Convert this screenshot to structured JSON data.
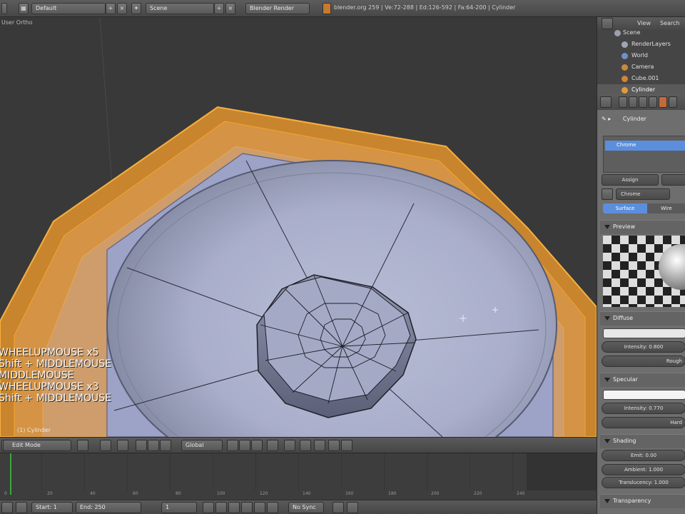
{
  "header": {
    "screen_layout": "Default",
    "scene": "Scene",
    "render_engine": "Blender Render",
    "stats": "blender.org 259 | Ve:72-288 | Ed:126-592 | Fa:64-200 | Cylinder"
  },
  "viewport": {
    "label": "User Ortho",
    "object_label": "(1) Cylinder",
    "key_history": [
      "WHEELUPMOUSE x5",
      "Shift + MIDDLEMOUSE",
      "MIDDLEMOUSE",
      "WHEELUPMOUSE x3",
      "Shift + MIDDLEMOUSE"
    ]
  },
  "view_header": {
    "mode": "Edit Mode",
    "orientation": "Global"
  },
  "timeline": {
    "frame_marks": [
      "0",
      "20",
      "40",
      "60",
      "80",
      "100",
      "120",
      "140",
      "160",
      "180",
      "200",
      "220",
      "240"
    ]
  },
  "timeline_header": {
    "start": "Start: 1",
    "end": "End: 250",
    "current": "1",
    "sync": "No Sync"
  },
  "outliner": {
    "menu_view": "View",
    "menu_search": "Search",
    "items": [
      "Scene",
      "RenderLayers",
      "World",
      "Camera",
      "Cube.001",
      "Cylinder"
    ]
  },
  "properties": {
    "object": "Cylinder",
    "material_slot": "Chrome",
    "assign": "Assign",
    "material_name": "Chrome",
    "tab_surface": "Surface",
    "tab_wire": "Wire",
    "panel_preview": "Preview",
    "panel_diffuse": "Diffuse",
    "diffuse_intensity": "Intensity: 0.800",
    "diffuse_shader": "Rough",
    "panel_specular": "Specular",
    "specular_intensity": "Intensity: 0.770",
    "specular_shader": "Hard",
    "panel_shading": "Shading",
    "emit": "Emit: 0.00",
    "ambient": "Ambient: 1.000",
    "translucency": "Translucency: 1.000",
    "panel_transparency": "Transparency"
  },
  "colors": {
    "selection_orange": "#f0a030",
    "active_blue": "#5b8fdd",
    "timeline_frame": "#3ea83e"
  }
}
